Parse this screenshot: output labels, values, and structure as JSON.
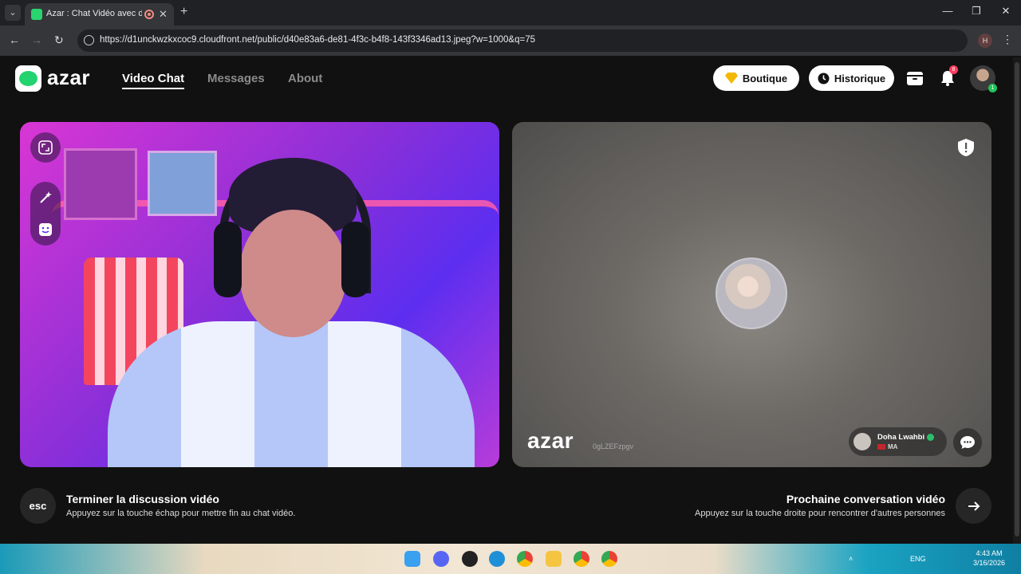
{
  "browser": {
    "tab_title": "Azar : Chat Vidéo avec de n",
    "url": "https://d1unckwzkxcoc9.cloudfront.net/public/d40e83a6-de81-4f3c-b4f8-143f3346ad13.jpeg?w=1000&q=75",
    "profile_initial": "H",
    "icons": [
      "chevron-down-icon",
      "favicon",
      "recording-icon",
      "close-icon",
      "plus-icon",
      "back-icon",
      "forward-icon",
      "reload-icon",
      "site-info-icon",
      "menu-icon"
    ]
  },
  "app": {
    "logo_text": "azar",
    "nav": {
      "video_chat": "Video Chat",
      "messages": "Messages",
      "about": "About"
    },
    "boutique_label": "Boutique",
    "historique_label": "Historique",
    "notification_count": "8",
    "avatar_badge": "1"
  },
  "partner": {
    "watermark": "azar",
    "watermark_id": "0gLZEFzpgv",
    "name": "Doha Lwahbi",
    "country": "MA"
  },
  "footer": {
    "esc_label": "esc",
    "end_title": "Terminer la discussion vidéo",
    "end_subtitle": "Appuyez sur la touche échap pour mettre fin au chat vidéo.",
    "next_title": "Prochaine conversation vidéo",
    "next_subtitle": "Appuyez sur la touche droite pour rencontrer d'autres personnes"
  },
  "taskbar": {
    "language": "ENG",
    "time": "4:43 AM",
    "date": "3/16/2026"
  },
  "colors": {
    "brand_green": "#22d36f",
    "accent_gold": "#f5b800"
  }
}
